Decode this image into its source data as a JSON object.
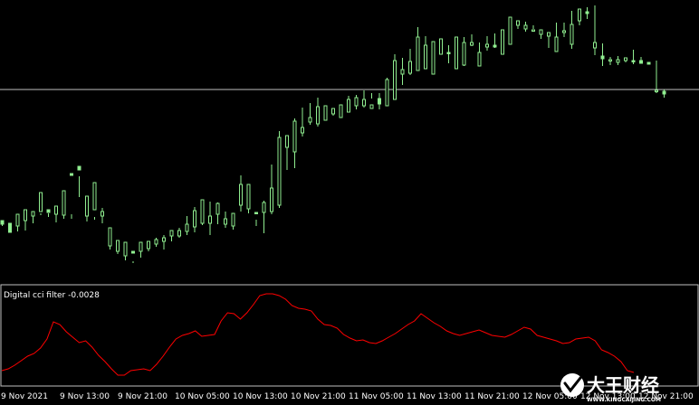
{
  "chart_data": [
    {
      "type": "candlestick",
      "title": "",
      "colors": {
        "background": "#000000",
        "candle": "#90EE90",
        "hline": "#C0C0C0",
        "frame": "#C0C0C0"
      },
      "price_line_level": 99,
      "candles": [
        [
          246,
          244,
          248,
          250
        ],
        [
          249,
          247,
          257,
          254
        ],
        [
          244,
          250,
          237,
          256
        ],
        [
          243,
          244,
          232,
          255
        ],
        [
          237,
          239,
          234,
          247
        ],
        [
          236,
          234,
          213,
          238
        ],
        [
          236,
          232,
          235,
          240
        ],
        [
          233,
          237,
          228,
          246
        ],
        [
          212,
          238,
          211,
          242
        ],
        [
          237,
          192,
          194,
          242
        ],
        [
          195,
          184,
          188,
          218
        ],
        [
          226,
          239,
          217,
          245
        ],
        [
          240,
          232,
          202,
          243
        ],
        [
          230,
          239,
          234,
          247
        ],
        [
          252,
          272,
          252,
          276
        ],
        [
          272,
          278,
          266,
          281
        ],
        [
          274,
          283,
          268,
          288
        ],
        [
          289,
          278,
          280,
          291
        ],
        [
          274,
          278,
          268,
          285
        ],
        [
          267,
          275,
          267,
          278
        ],
        [
          263,
          270,
          265,
          273
        ],
        [
          260,
          267,
          263,
          276
        ],
        [
          258,
          261,
          255,
          267
        ],
        [
          252,
          261,
          255,
          263
        ],
        [
          239,
          256,
          248,
          260
        ],
        [
          229,
          251,
          233,
          257
        ],
        [
          232,
          247,
          221,
          249
        ],
        [
          223,
          247,
          239,
          260
        ],
        [
          224,
          237,
          225,
          248
        ],
        [
          234,
          248,
          242,
          252
        ],
        [
          241,
          250,
          236,
          254
        ],
        [
          194,
          227,
          204,
          234
        ],
        [
          216,
          231,
          204,
          236
        ],
        [
          243,
          235,
          236,
          250
        ],
        [
          222,
          235,
          224,
          258
        ],
        [
          182,
          234,
          208,
          237
        ],
        [
          145,
          227,
          152,
          230
        ],
        [
          150,
          163,
          150,
          188
        ],
        [
          131,
          168,
          134,
          186
        ],
        [
          119,
          147,
          141,
          151
        ],
        [
          114,
          135,
          130,
          138
        ],
        [
          108,
          137,
          118,
          140
        ],
        [
          121,
          133,
          117,
          127
        ],
        [
          122,
          126,
          120,
          128
        ],
        [
          119,
          130,
          116,
          124
        ],
        [
          106,
          124,
          110,
          119
        ],
        [
          105,
          117,
          108,
          121
        ],
        [
          100,
          117,
          110,
          119
        ],
        [
          103,
          120,
          116,
          109
        ],
        [
          103,
          109,
          115,
          121
        ],
        [
          86,
          117,
          88,
          109
        ],
        [
          60,
          110,
          67,
          91
        ],
        [
          64,
          82,
          77,
          94
        ],
        [
          54,
          81,
          68,
          83
        ],
        [
          30,
          78,
          41,
          74
        ],
        [
          40,
          76,
          50,
          66
        ],
        [
          49,
          82,
          46,
          76
        ],
        [
          60,
          60,
          43,
          55
        ],
        [
          50,
          58,
          58,
          70
        ],
        [
          43,
          76,
          41,
          74
        ],
        [
          41,
          72,
          47,
          73
        ],
        [
          38,
          50,
          47,
          51
        ],
        [
          47,
          73,
          58,
          67
        ],
        [
          40,
          52,
          49,
          56
        ],
        [
          37,
          50,
          52,
          53
        ],
        [
          52,
          60,
          33,
          54
        ],
        [
          33,
          49,
          19,
          39
        ],
        [
          28,
          28,
          23,
          32
        ],
        [
          24,
          32,
          28,
          35
        ],
        [
          28,
          34,
          33,
          32
        ],
        [
          38,
          38,
          33,
          43
        ],
        [
          38,
          40,
          36,
          53
        ],
        [
          25,
          57,
          41,
          43
        ],
        [
          25,
          36,
          34,
          41
        ],
        [
          12,
          49,
          27,
          54
        ],
        [
          11,
          23,
          10,
          28
        ],
        [
          8,
          13,
          15,
          21
        ],
        [
          6,
          53,
          47,
          61
        ],
        [
          48,
          62,
          65,
          73
        ],
        [
          63,
          67,
          66,
          72
        ],
        [
          62,
          69,
          66,
          72
        ],
        [
          66,
          67,
          64,
          69
        ],
        [
          55,
          67,
          67,
          71
        ],
        [
          67,
          67,
          70,
          63
        ],
        [
          69,
          69,
          71,
          70
        ],
        [
          67,
          101,
          100,
          103
        ],
        [
          99,
          101,
          104,
          108
        ]
      ],
      "x_tick_labels": [
        "9 Nov 2021",
        "9 Nov 13:00",
        "9 Nov 21:00",
        "10 Nov 05:00",
        "10 Nov 13:00",
        "10 Nov 21:00",
        "11 Nov 05:00",
        "11 Nov 13:00",
        "11 Nov 21:00",
        "12 Nov 05:00",
        "12 Nov 13:00",
        "12 Nov 21:00"
      ]
    },
    {
      "type": "line",
      "title": "Digital cci filter -0.0028",
      "colors": {
        "line": "#FF0000"
      },
      "values": [
        410,
        408,
        404,
        399,
        394,
        391,
        385,
        375,
        356,
        359,
        367,
        373,
        379,
        377,
        384,
        393,
        400,
        408,
        415,
        415,
        410,
        409,
        408,
        410,
        403,
        394,
        384,
        375,
        371,
        369,
        366,
        372,
        371,
        370,
        355,
        346,
        347,
        353,
        346,
        337,
        327,
        325,
        325,
        327,
        331,
        338,
        341,
        342,
        344,
        353,
        359,
        360,
        363,
        370,
        374,
        377,
        376,
        379,
        380,
        377,
        373,
        369,
        364,
        359,
        355,
        347,
        352,
        357,
        361,
        366,
        369,
        371,
        369,
        367,
        365,
        368,
        371,
        372,
        373,
        370,
        366,
        362,
        364,
        371,
        373,
        375,
        377,
        380,
        379,
        375,
        374,
        373,
        377,
        387,
        390,
        394,
        400,
        410,
        412
      ]
    }
  ],
  "watermark": {
    "brand": "大王财经",
    "url": "WWW.KINGCAIJING.COM"
  }
}
